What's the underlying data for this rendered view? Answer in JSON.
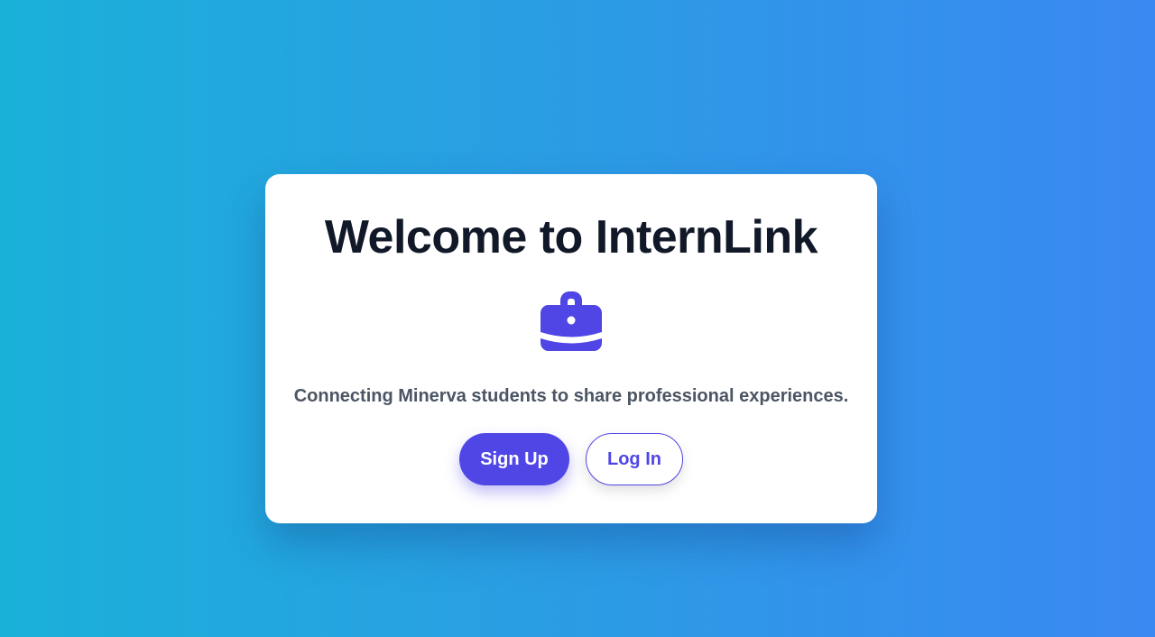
{
  "welcome": {
    "title": "Welcome to InternLink",
    "icon": "briefcase-icon",
    "tagline": "Connecting Minerva students to share professional experiences.",
    "signup_label": "Sign Up",
    "login_label": "Log In"
  },
  "colors": {
    "accent": "#4f46e5",
    "title": "#111827",
    "tagline": "#4b5563",
    "background_start": "#1ab1d9",
    "background_end": "#3a88f2"
  }
}
